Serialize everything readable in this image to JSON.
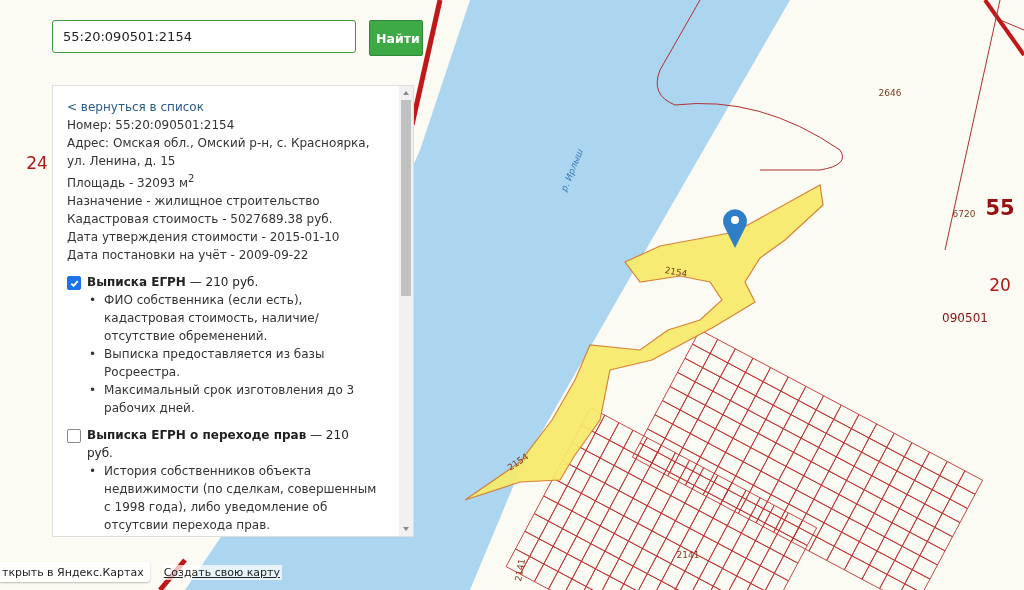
{
  "search": {
    "value": "55:20:090501:2154",
    "button": "Найти"
  },
  "panel": {
    "back_link": "< вернуться в список",
    "info": [
      "Номер: 55:20:090501:2154",
      "Адрес: Омская обл., Омский р-н, с. Красноярка, ул. Ленина, д. 15",
      "Площадь - 32093 м$^{2}$",
      "Назначение - жилищное строительство",
      "Кадастровая стоимость - 5027689.38 руб.",
      "Дата утверждения стоимости - 2015-01-10",
      "Дата постановки на учёт - 2009-09-22"
    ],
    "options": [
      {
        "bullet": "•",
        "label": "**Выписка ЕГРН** — 210 руб.",
        "checked": true,
        "bullets": [
          "ФИО собственника (если есть), кадастровая стоимость, наличие/ отсутствие обременений.",
          "Выписка предоставляется из базы Росреестра.",
          "Максимальный срок изготовления до 3 рабочих дней."
        ]
      },
      {
        "bullet": "•",
        "label": "**Выписка ЕГРН о переходе прав** — 210 руб.",
        "checked": false,
        "bullets": [
          "История собственников объекта недвижимости (по сделкам, совершенным с 1998 года), либо уведомление об отсутсвии перехода прав."
        ]
      }
    ]
  },
  "map_labels": [
    {
      "text": "24",
      "kind": "district"
    },
    {
      "text": "55",
      "kind": "region"
    },
    {
      "text": "20",
      "kind": "district"
    },
    {
      "text": "090501",
      "kind": "quarter"
    },
    {
      "text": "2646",
      "kind": "parcel"
    },
    {
      "text": "6720",
      "kind": "parcel"
    },
    {
      "text": "2154",
      "kind": "parcel"
    },
    {
      "text": "2154",
      "kind": "parcel"
    },
    {
      "text": "р. Ирлыш",
      "kind": "river"
    },
    {
      "text": "2141",
      "kind": "parcel"
    },
    {
      "text": "2141",
      "kind": "parcel"
    }
  ],
  "footer": {
    "open_button": "ткрыть в Яндекс.Картах",
    "create_link": "Создать свою карту"
  }
}
